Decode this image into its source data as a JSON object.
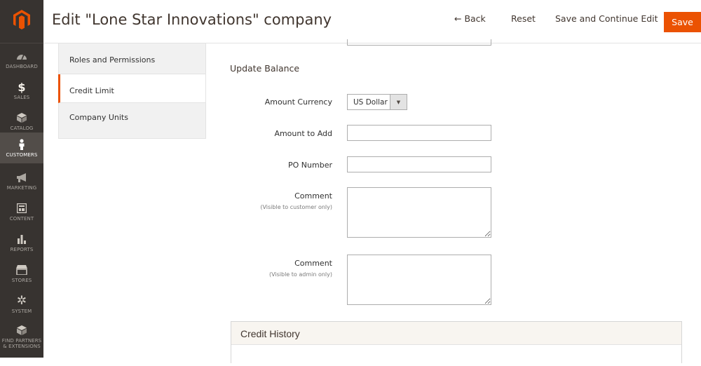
{
  "nav": {
    "items": [
      {
        "label": "Dashboard",
        "icon": "dashboard-icon"
      },
      {
        "label": "Sales",
        "icon": "dollar-icon"
      },
      {
        "label": "Catalog",
        "icon": "box-icon"
      },
      {
        "label": "Customers",
        "icon": "person-icon"
      },
      {
        "label": "Marketing",
        "icon": "megaphone-icon"
      },
      {
        "label": "Content",
        "icon": "layout-icon"
      },
      {
        "label": "Reports",
        "icon": "bar-chart-icon"
      },
      {
        "label": "Stores",
        "icon": "storefront-icon"
      },
      {
        "label": "System",
        "icon": "gear-icon"
      },
      {
        "label": "Find Partners",
        "label2": "& Extensions",
        "icon": "cube-icon"
      }
    ],
    "active_index": 3
  },
  "header": {
    "title": "Edit \"Lone Star Innovations\" company",
    "back_label": "← Back",
    "reset_label": "Reset",
    "save_continue_label": "Save and Continue Edit",
    "save_label": "Save"
  },
  "tabs": [
    {
      "label": "Roles and Permissions"
    },
    {
      "label": "Credit Limit"
    },
    {
      "label": "Company Units"
    }
  ],
  "form": {
    "section_title": "Update Balance",
    "amount_currency_label": "Amount Currency",
    "amount_currency_value": "US Dollar",
    "amount_to_add_label": "Amount to Add",
    "amount_to_add_value": "",
    "po_number_label": "PO Number",
    "po_number_value": "",
    "comment_customer_label": "Comment",
    "comment_customer_note": "(Visible to customer only)",
    "comment_admin_label": "Comment",
    "comment_admin_note": "(Visible to admin only)"
  },
  "credit_history": {
    "title": "Credit History"
  },
  "colors": {
    "accent": "#eb5202",
    "nav_bg": "#373330",
    "nav_active": "#524d49"
  }
}
